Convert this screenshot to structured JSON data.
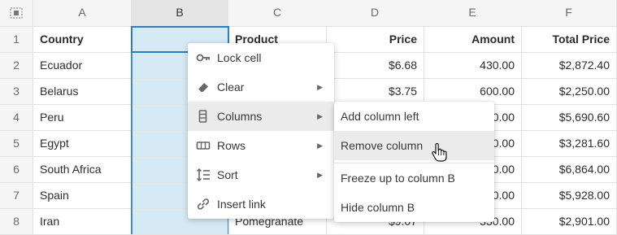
{
  "columns": [
    "A",
    "B",
    "C",
    "D",
    "E",
    "F"
  ],
  "rows": [
    {
      "n": "1",
      "a": "Country",
      "c": "Product",
      "d": "Price",
      "e": "Amount",
      "f": "Total Price"
    },
    {
      "n": "2",
      "a": "Ecuador",
      "c": "",
      "d": "$6.68",
      "e": "430.00",
      "f": "$2,872.40"
    },
    {
      "n": "3",
      "a": "Belarus",
      "c": "",
      "d": "$3.75",
      "e": "600.00",
      "f": "$2,250.00"
    },
    {
      "n": "4",
      "a": "Peru",
      "c": "",
      "d": "",
      "e": "0.00",
      "f": "$5,690.60"
    },
    {
      "n": "5",
      "a": "Egypt",
      "c": "",
      "d": "",
      "e": "0.00",
      "f": "$3,281.60"
    },
    {
      "n": "6",
      "a": "South Africa",
      "c": "",
      "d": "",
      "e": "0.00",
      "f": "$6,864.00"
    },
    {
      "n": "7",
      "a": "Spain",
      "c": "",
      "d": "",
      "e": "0.00",
      "f": "$5,928.00"
    },
    {
      "n": "8",
      "a": "Iran",
      "c": "Pomegranate",
      "d": "$9.07",
      "e": "330.00",
      "f": "$2,901.00"
    }
  ],
  "context_menu": {
    "items": [
      {
        "label": "Lock cell",
        "icon": "key-icon",
        "submenu": false
      },
      {
        "label": "Clear",
        "icon": "eraser-icon",
        "submenu": true
      },
      {
        "label": "Columns",
        "icon": "columns-icon",
        "submenu": true,
        "active": true
      },
      {
        "label": "Rows",
        "icon": "rows-icon",
        "submenu": true
      },
      {
        "label": "Sort",
        "icon": "sort-icon",
        "submenu": true
      },
      {
        "label": "Insert link",
        "icon": "link-icon",
        "submenu": false
      }
    ]
  },
  "columns_submenu": {
    "items": [
      {
        "label": "Add column left"
      },
      {
        "label": "Remove column",
        "active": true
      },
      {
        "label": "Freeze up to column B"
      },
      {
        "label": "Hide column B"
      }
    ]
  },
  "colors": {
    "selection": "#d6eaf5",
    "selection_border": "#2a7fc0",
    "header_bg": "#f5f5f5"
  }
}
